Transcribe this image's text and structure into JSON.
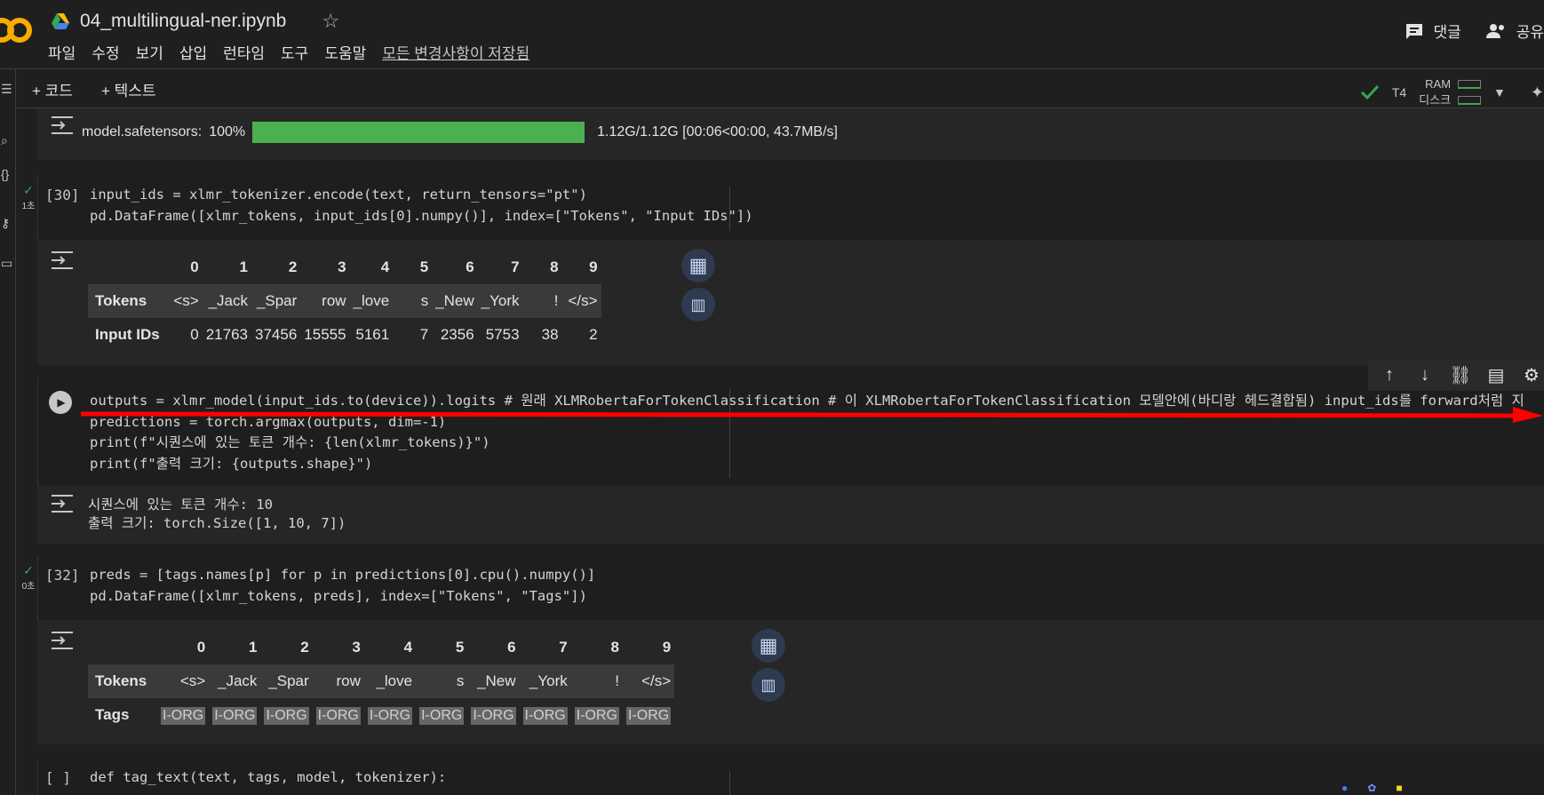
{
  "app": {
    "title": "04_multilingual-ner.ipynb",
    "star_glyph": "☆",
    "menu": [
      "파일",
      "수정",
      "보기",
      "삽입",
      "런타임",
      "도구",
      "도움말"
    ],
    "saved_status": "모든 변경사항이 저장됨",
    "comment_label": "댓글",
    "share_label": "공유"
  },
  "toolbar": {
    "add_code": "+ 코드",
    "add_text": "+ 텍스트",
    "runtime": "T4",
    "ram_label": "RAM",
    "disk_label": "디스크"
  },
  "download_progress": {
    "label": "model.safetensors:",
    "percent_text": "100%",
    "progress": 1.0,
    "stats": "1.12G/1.12G  [00:06<00:00,  43.7MB/s]"
  },
  "cells": {
    "c30": {
      "count": "[30]",
      "status_time": "1초",
      "code": [
        "input_ids = xlmr_tokenizer.encode(text, return_tensors=\"pt\")",
        "pd.DataFrame([xlmr_tokens, input_ids[0].numpy()], index=[\"Tokens\", \"Input IDs\"])"
      ],
      "table": {
        "columns": [
          "",
          "0",
          "1",
          "2",
          "3",
          "4",
          "5",
          "6",
          "7",
          "8",
          "9"
        ],
        "rows": [
          [
            "Tokens",
            "<s>",
            "_Jack",
            "_Spar",
            "row",
            "_love",
            "s",
            "_New",
            "_York",
            "!",
            "</s>"
          ],
          [
            "Input IDs",
            "0",
            "21763",
            "37456",
            "15555",
            "5161",
            "7",
            "2356",
            "5753",
            "38",
            "2"
          ]
        ]
      }
    },
    "c31": {
      "code": [
        "outputs = xlmr_model(input_ids.to(device)).logits # 원래 XLMRobertaForTokenClassification # 이 XLMRobertaForTokenClassification 모델안에(바디랑 헤드결합됨) input_ids를 forward처럼 지",
        "predictions = torch.argmax(outputs, dim=-1)",
        "print(f\"시퀀스에 있는 토큰 개수: {len(xlmr_tokens)}\")",
        "print(f\"출력 크기: {outputs.shape}\")"
      ],
      "output": [
        "시퀀스에 있는 토큰 개수: 10",
        "출력 크기: torch.Size([1, 10, 7])"
      ]
    },
    "c32": {
      "count": "[32]",
      "status_time": "0초",
      "code": [
        "preds = [tags.names[p] for p in predictions[0].cpu().numpy()]",
        "pd.DataFrame([xlmr_tokens, preds], index=[\"Tokens\", \"Tags\"])"
      ],
      "table": {
        "columns": [
          "",
          "0",
          "1",
          "2",
          "3",
          "4",
          "5",
          "6",
          "7",
          "8",
          "9"
        ],
        "rows": [
          [
            "Tokens",
            "<s>",
            "_Jack",
            "_Spar",
            "row",
            "_love",
            "s",
            "_New",
            "_York",
            "!",
            "</s>"
          ],
          [
            "Tags",
            "I-ORG",
            "I-ORG",
            "I-ORG",
            "I-ORG",
            "I-ORG",
            "I-ORG",
            "I-ORG",
            "I-ORG",
            "I-ORG",
            "I-ORG"
          ]
        ]
      }
    },
    "c33": {
      "count": "[ ]",
      "code": [
        "def tag_text(text, tags, model, tokenizer):"
      ]
    }
  },
  "colors": {
    "accent": "#34a853",
    "annotation_arrow": "#ff0000",
    "progress": "#4caf50"
  }
}
